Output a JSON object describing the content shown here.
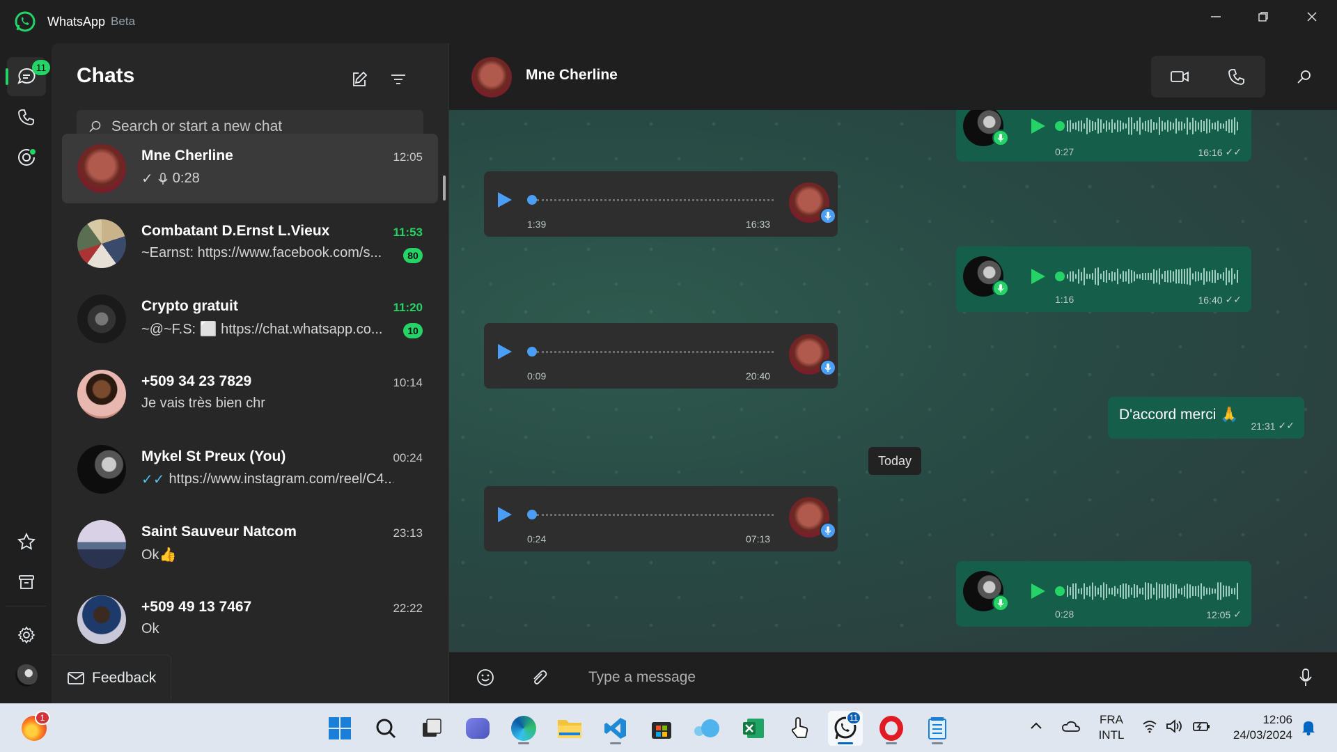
{
  "app": {
    "name": "WhatsApp",
    "badge": "Beta"
  },
  "rail": {
    "chats_badge": "11"
  },
  "chat_list": {
    "title": "Chats",
    "search_placeholder": "Search or start a new chat",
    "items": [
      {
        "name": "Mne Cherline",
        "time": "12:05",
        "preview": "0:28",
        "tick": "✓",
        "unread": ""
      },
      {
        "name": "Combatant D.Ernst L.Vieux",
        "time": "11:53",
        "preview": "~Earnst: https://www.facebook.com/s...",
        "unread": "80"
      },
      {
        "name": "Crypto gratuit",
        "time": "11:20",
        "preview": "~@~F.S: ⬜ https://chat.whatsapp.co...",
        "unread": "10"
      },
      {
        "name": "+509 34 23 7829",
        "time": "10:14",
        "preview": "Je vais très bien chr",
        "unread": ""
      },
      {
        "name": "Mykel St Preux (You)",
        "time": "00:24",
        "preview": "https://www.instagram.com/reel/C4...",
        "tick": "✓✓",
        "unread": ""
      },
      {
        "name": "Saint Sauveur Natcom",
        "time": "23:13",
        "preview": "Ok👍",
        "unread": ""
      },
      {
        "name": "+509 49 13 7467",
        "time": "22:22",
        "preview": "Ok",
        "unread": ""
      }
    ],
    "feedback_label": "Feedback"
  },
  "conversation": {
    "contact_name": "Mne Cherline",
    "day_separator": "Today",
    "composer_placeholder": "Type a message",
    "messages": [
      {
        "dir": "out",
        "type": "voice",
        "duration": "0:27",
        "time": "16:16",
        "ticks": "✓✓"
      },
      {
        "dir": "in",
        "type": "voice",
        "duration": "1:39",
        "time": "16:33"
      },
      {
        "dir": "out",
        "type": "voice",
        "duration": "1:16",
        "time": "16:40",
        "ticks": "✓✓"
      },
      {
        "dir": "in",
        "type": "voice",
        "duration": "0:09",
        "time": "20:40"
      },
      {
        "dir": "out",
        "type": "text",
        "text": "D'accord merci 🙏",
        "time": "21:31",
        "ticks": "✓✓"
      },
      {
        "dir": "in",
        "type": "voice",
        "duration": "0:24",
        "time": "07:13"
      },
      {
        "dir": "out",
        "type": "voice",
        "duration": "0:28",
        "time": "12:05",
        "ticks": "✓"
      }
    ]
  },
  "taskbar": {
    "firefox_badge": "1",
    "whatsapp_badge": "11",
    "lang_line1": "FRA",
    "lang_line2": "INTL",
    "time": "12:06",
    "date": "24/03/2024"
  },
  "colors": {
    "accent": "#25d366",
    "outgoing_bubble": "#155f4a",
    "incoming_bubble": "#2e2e2e",
    "voice_in": "#4a9ef5"
  }
}
